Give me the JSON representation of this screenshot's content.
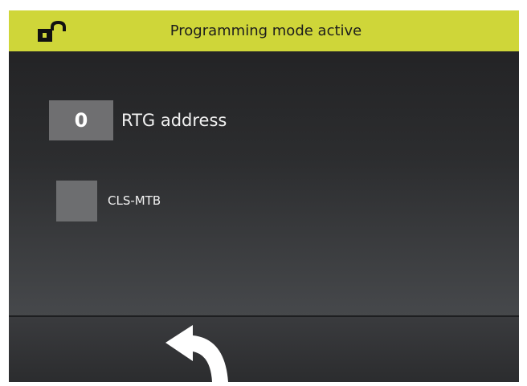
{
  "header": {
    "title": "Programming mode active",
    "lock_icon": "unlocked-padlock-icon",
    "background_color": "#cfd639"
  },
  "settings": {
    "rtg_address": {
      "value": "0",
      "label": "RTG address"
    },
    "cls_mtb": {
      "label": "CLS-MTB",
      "checked": false
    }
  },
  "footer": {
    "back_icon": "back-arrow-icon"
  }
}
